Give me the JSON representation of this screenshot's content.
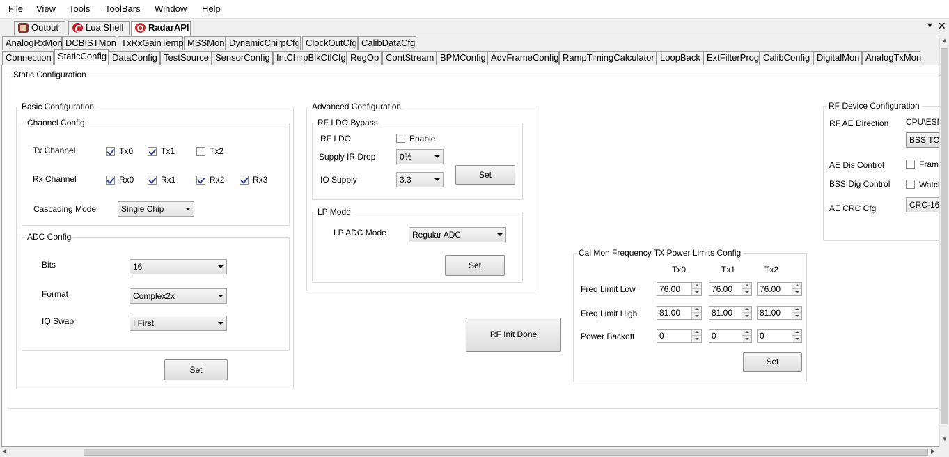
{
  "menu": [
    "File",
    "View",
    "Tools",
    "ToolBars",
    "Window",
    "Help"
  ],
  "doc_tabs": [
    "Output",
    "Lua Shell",
    "RadarAPI"
  ],
  "tabs_row1": [
    "AnalogRxMon",
    "DCBISTMon",
    "TxRxGainTemp",
    "MSSMon",
    "DynamicChirpCfg",
    "ClockOutCfg",
    "CalibDataCfg"
  ],
  "tabs_row2": [
    "Connection",
    "StaticConfig",
    "DataConfig",
    "TestSource",
    "SensorConfig",
    "IntChirpBlkCtlCfg",
    "RegOp",
    "ContStream",
    "BPMConfig",
    "AdvFrameConfig",
    "RampTimingCalculator",
    "LoopBack",
    "ExtFilterProg",
    "CalibConfig",
    "DigitalMon",
    "AnalogTxMon"
  ],
  "static_cfg": {
    "title": "Static Configuration",
    "basic": {
      "title": "Basic Configuration",
      "channel": {
        "title": "Channel Config",
        "tx_label": "Tx Channel",
        "tx": [
          {
            "label": "Tx0",
            "checked": true
          },
          {
            "label": "Tx1",
            "checked": true
          },
          {
            "label": "Tx2",
            "checked": false
          }
        ],
        "rx_label": "Rx Channel",
        "rx": [
          {
            "label": "Rx0",
            "checked": true
          },
          {
            "label": "Rx1",
            "checked": true
          },
          {
            "label": "Rx2",
            "checked": true
          },
          {
            "label": "Rx3",
            "checked": true
          }
        ],
        "cascading_label": "Cascading Mode",
        "cascading_value": "Single Chip"
      },
      "adc": {
        "title": "ADC Config",
        "bits_label": "Bits",
        "bits_value": "16",
        "format_label": "Format",
        "format_value": "Complex2x",
        "iq_label": "IQ Swap",
        "iq_value": "I First"
      },
      "set": "Set"
    },
    "advanced": {
      "title": "Advanced Configuration",
      "ldo": {
        "title": "RF LDO Bypass",
        "rf_ldo_label": "RF LDO",
        "enable_label": "Enable",
        "enable_checked": false,
        "supply_ir_label": "Supply IR Drop",
        "supply_ir_value": "0%",
        "io_supply_label": "IO Supply",
        "io_supply_value": "3.3",
        "set": "Set"
      },
      "lp": {
        "title": "LP Mode",
        "adc_mode_label": "LP ADC Mode",
        "adc_mode_value": "Regular ADC",
        "set": "Set"
      }
    },
    "rf_init_done": "RF Init Done",
    "cal_mon": {
      "title": "Cal Mon Frequency TX Power Limits Config",
      "cols": [
        "Tx0",
        "Tx1",
        "Tx2"
      ],
      "rows": [
        {
          "label": "Freq Limit Low",
          "values": [
            "76.00",
            "76.00",
            "76.00"
          ]
        },
        {
          "label": "Freq Limit High",
          "values": [
            "81.00",
            "81.00",
            "81.00"
          ]
        },
        {
          "label": "Power Backoff",
          "values": [
            "0",
            "0",
            "0"
          ]
        }
      ],
      "set": "Set"
    },
    "rf_device": {
      "title": "RF Device Configuration",
      "ae_dir_label": "RF AE Direction",
      "ae_dir_value": "CPU\\ESM",
      "ae_dir_combo": "BSS TO",
      "ae_dis_label": "AE Dis Control",
      "ae_dis_cb": "Fram",
      "bss_dig_label": "BSS Dig Control",
      "bss_dig_cb": "Watch",
      "crc_label": "AE CRC Cfg",
      "crc_value": "CRC-16"
    }
  }
}
